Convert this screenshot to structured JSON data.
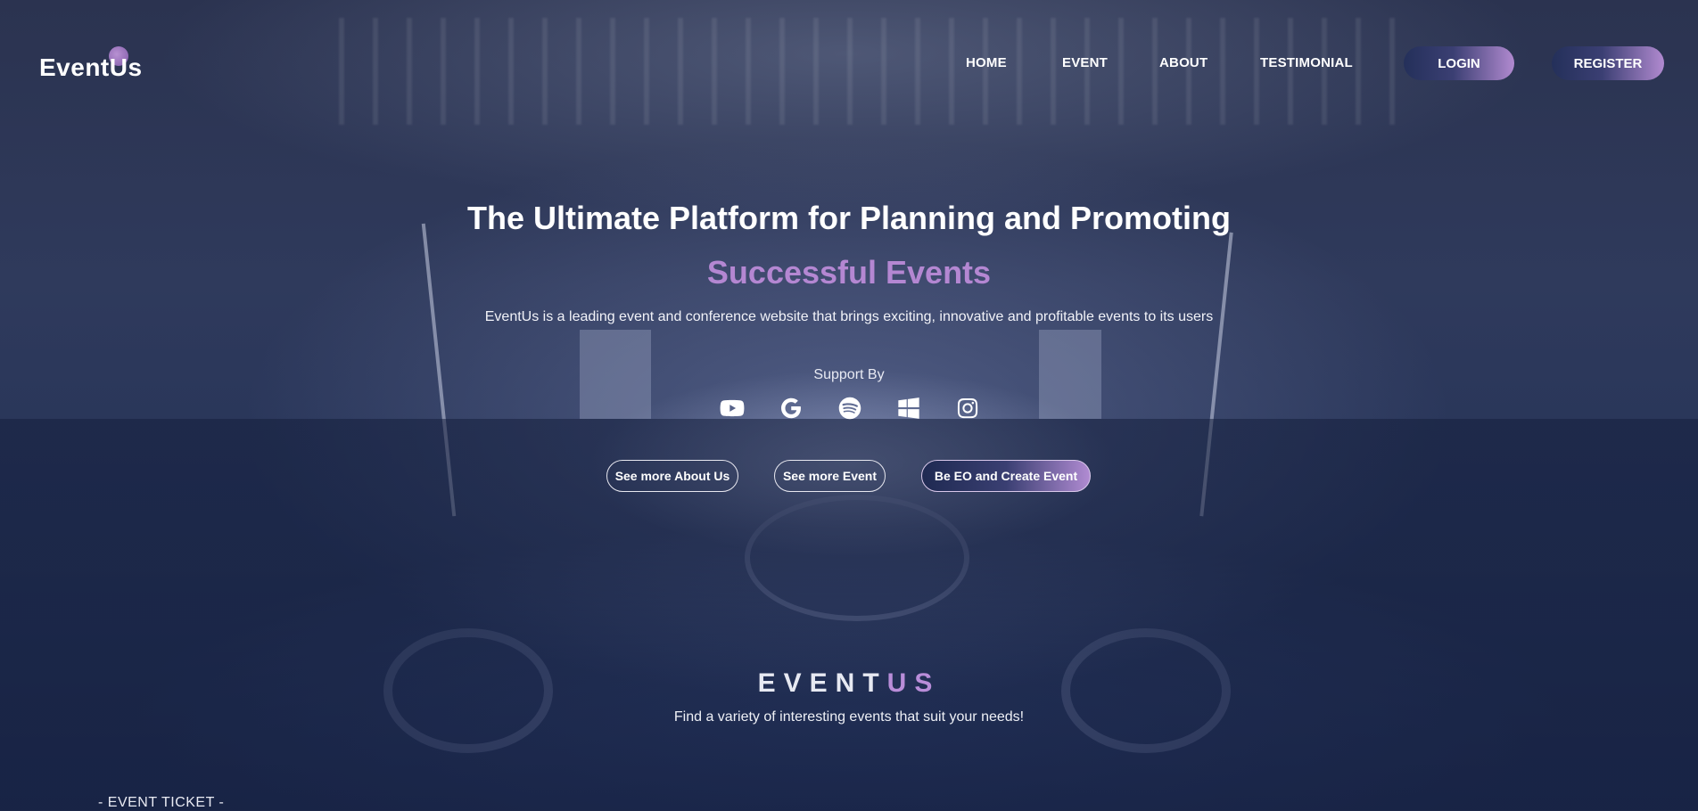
{
  "brand": {
    "logo_text": "EventUs",
    "accent_color": "#b487d2"
  },
  "nav": {
    "items": [
      "HOME",
      "EVENT",
      "ABOUT",
      "TESTIMONIAL"
    ],
    "login": "LOGIN",
    "register": "REGISTER"
  },
  "hero": {
    "title": "The Ultimate Platform for Planning and Promoting",
    "accent": "Successful Events",
    "description": "EventUs is a leading event and conference website that brings exciting, innovative and profitable events to its users",
    "support_label": "Support By",
    "support_icons": [
      "youtube-icon",
      "google-icon",
      "spotify-icon",
      "windows-icon",
      "instagram-icon"
    ],
    "buttons": [
      "See more About Us",
      "See more Event",
      "Be EO and Create Event"
    ]
  },
  "section": {
    "brand_part1": "EVENT",
    "brand_part2": "US",
    "subtitle": "Find a variety of interesting events that suit your needs!",
    "ticket_label": "- EVENT TICKET -"
  }
}
